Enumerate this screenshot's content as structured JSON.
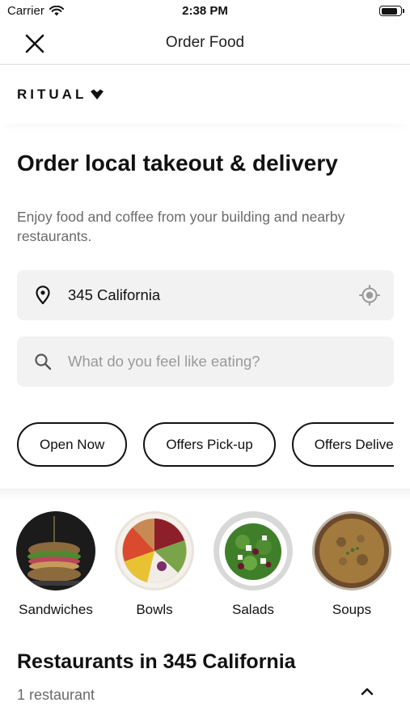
{
  "status_bar": {
    "carrier": "Carrier",
    "time": "2:38 PM",
    "battery_level": 0.9
  },
  "nav": {
    "title": "Order Food",
    "close_icon": "close-icon"
  },
  "brand": {
    "name": "RITUAL",
    "logo_icon": "heart-chevron-icon"
  },
  "hero": {
    "title": "Order local takeout & delivery",
    "subtitle": "Enjoy food and coffee from your building and nearby restaurants."
  },
  "address": {
    "value": "345 California",
    "icon": "location-pin-icon",
    "locate_icon": "crosshair-icon"
  },
  "search": {
    "placeholder": "What do you feel like eating?",
    "icon": "search-icon"
  },
  "filters": [
    {
      "label": "Open Now"
    },
    {
      "label": "Offers Pick-up"
    },
    {
      "label": "Offers Delivery"
    }
  ],
  "categories": [
    {
      "label": "Sandwiches"
    },
    {
      "label": "Bowls"
    },
    {
      "label": "Salads"
    },
    {
      "label": "Soups"
    }
  ],
  "restaurants": {
    "title": "Restaurants in 345 California",
    "count_text": "1 restaurant",
    "toggle_icon": "chevron-up-icon"
  },
  "colors": {
    "text": "#111111",
    "muted": "#6a6a6a",
    "field_bg": "#f2f2f2",
    "divider": "#dcdcdc"
  }
}
